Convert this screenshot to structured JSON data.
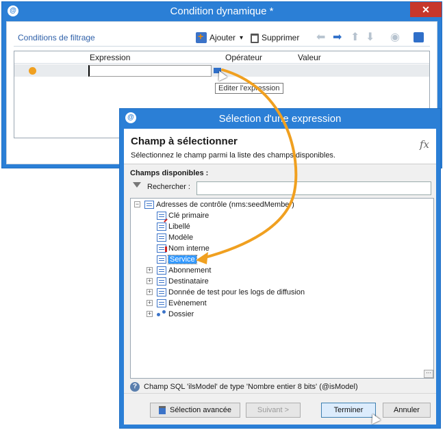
{
  "main_window": {
    "title": "Condition dynamique *",
    "app_icon_glyph": "@",
    "close_glyph": "✕",
    "filter_link": "Conditions de filtrage",
    "toolbar": {
      "add_label": "Ajouter",
      "add_caret": "▾",
      "delete_label": "Supprimer"
    },
    "grid": {
      "columns": [
        "Expression",
        "Opérateur",
        "Valeur"
      ]
    },
    "tooltip": "Editer l'expression"
  },
  "dialog": {
    "title": "Sélection d'une expression",
    "heading": "Champ à sélectionner",
    "subheading": "Sélectionnez le champ parmi la liste des champs disponibles.",
    "fx_label": "fx",
    "fields_label": "Champs disponibles :",
    "search_label": "Rechercher :",
    "search_value": "",
    "tree": {
      "root": "Adresses de contrôle (nms:seedMember)",
      "children": [
        "Clé primaire",
        "Libellé",
        "Modèle",
        "Nom interne",
        "Service"
      ],
      "collapsed": [
        "Abonnement",
        "Destinataire",
        "Donnée de test pour les logs de diffusion",
        "Evènement",
        "Dossier"
      ],
      "selected": "Service"
    },
    "info_text": "Champ SQL 'ilsModel' de type 'Nombre entier 8 bits' (@isModel)",
    "buttons": {
      "advanced": "Sélection avancée",
      "next": "Suivant >",
      "finish": "Terminer",
      "cancel": "Annuler"
    }
  },
  "colors": {
    "window_chrome": "#2b7fd6",
    "close_button": "#c7372b",
    "arrow_annotation": "#f0a020",
    "selection": "#3399ff"
  }
}
